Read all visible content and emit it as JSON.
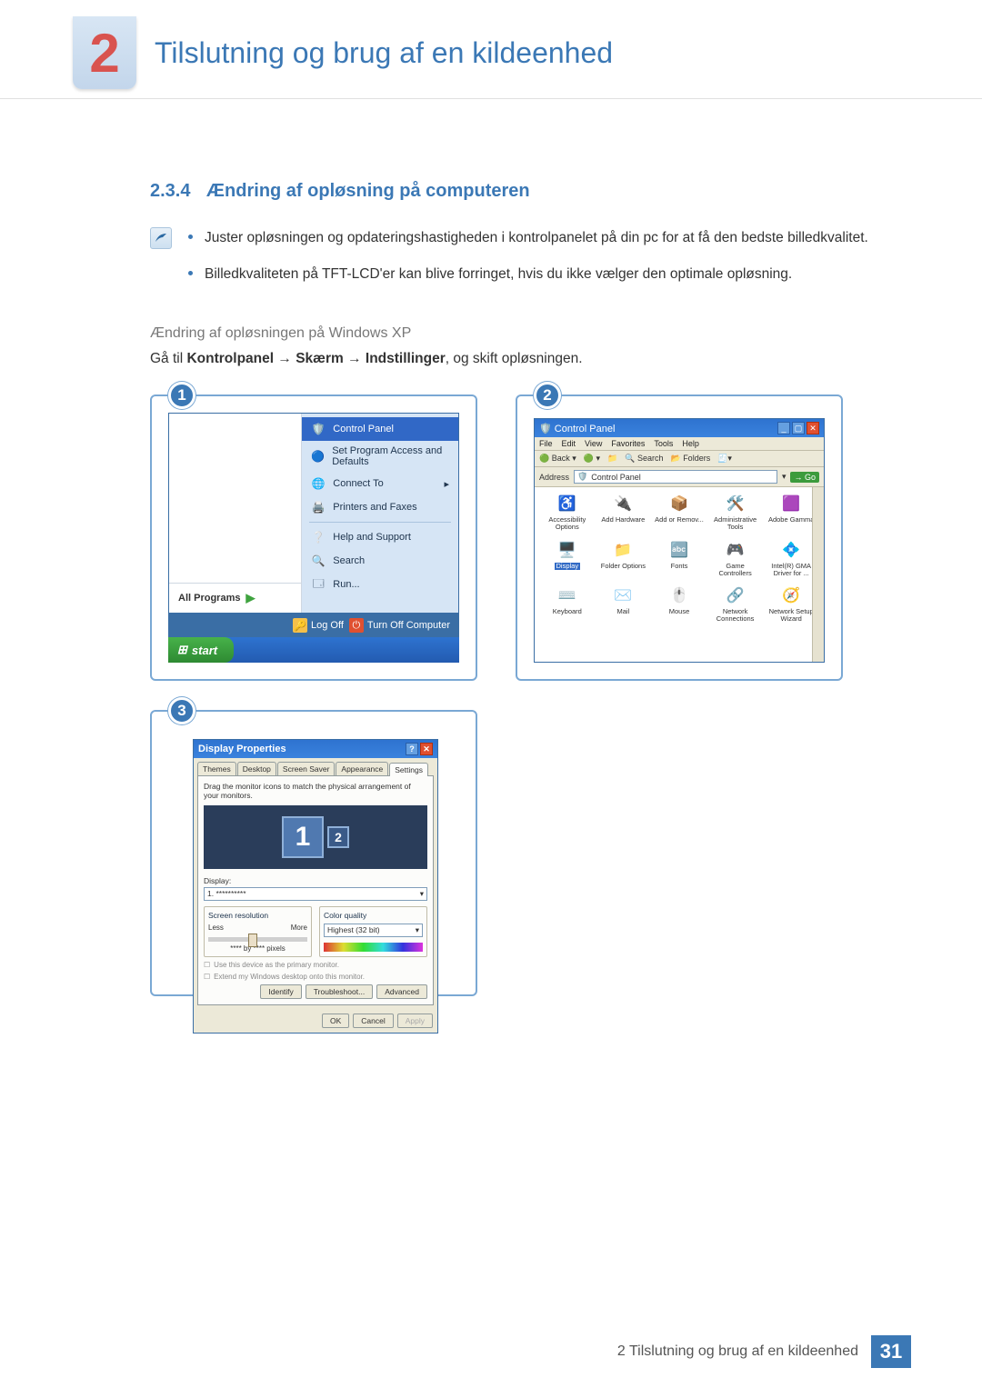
{
  "chapter": {
    "number": "2",
    "title": "Tilslutning og brug af en kildeenhed"
  },
  "section": {
    "number": "2.3.4",
    "title": "Ændring af opløsning på computeren"
  },
  "bullets": [
    "Juster opløsningen og opdateringshastigheden i kontrolpanelet på din pc for at få den bedste billedkvalitet.",
    "Billedkvaliteten på TFT-LCD'er kan blive forringet, hvis du ikke vælger den optimale opløsning."
  ],
  "subhead": "Ændring af opløsningen på Windows XP",
  "path": {
    "prefix": "Gå til ",
    "a": "Kontrolpanel",
    "arrow": " → ",
    "b": "Skærm",
    "c": "Indstillinger",
    "suffix": ", og skift opløsningen."
  },
  "startmenu": {
    "badge": "1",
    "items": [
      {
        "icon": "🛡️",
        "label": "Control Panel",
        "highlight": true
      },
      {
        "icon": "🔵",
        "label": "Set Program Access and Defaults"
      },
      {
        "icon": "🌐",
        "label": "Connect To",
        "arrow": "▸"
      },
      {
        "icon": "🖨️",
        "label": "Printers and Faxes"
      },
      {
        "icon": "❔",
        "label": "Help and Support"
      },
      {
        "icon": "🔍",
        "label": "Search"
      },
      {
        "icon": "🗔",
        "label": "Run..."
      }
    ],
    "all_programs": "All Programs",
    "logoff": "Log Off",
    "turnoff": "Turn Off Computer",
    "start": "start"
  },
  "cp": {
    "badge": "2",
    "title": "Control Panel",
    "menus": [
      "File",
      "Edit",
      "View",
      "Favorites",
      "Tools",
      "Help"
    ],
    "tool_back": "Back",
    "tool_search": "Search",
    "tool_folders": "Folders",
    "addr_label": "Address",
    "addr_value": "Control Panel",
    "go": "Go",
    "items": [
      {
        "ico": "♿",
        "label": "Accessibility Options"
      },
      {
        "ico": "🔌",
        "label": "Add Hardware"
      },
      {
        "ico": "📦",
        "label": "Add or Remov..."
      },
      {
        "ico": "🛠️",
        "label": "Administrative Tools"
      },
      {
        "ico": "🟪",
        "label": "Adobe Gamma"
      },
      {
        "ico": "🖥️",
        "label": "Display",
        "sel": true
      },
      {
        "ico": "📁",
        "label": "Folder Options"
      },
      {
        "ico": "🔤",
        "label": "Fonts"
      },
      {
        "ico": "🎮",
        "label": "Game Controllers"
      },
      {
        "ico": "💠",
        "label": "Intel(R) GMA Driver for ..."
      },
      {
        "ico": "⌨️",
        "label": "Keyboard"
      },
      {
        "ico": "✉️",
        "label": "Mail"
      },
      {
        "ico": "🖱️",
        "label": "Mouse"
      },
      {
        "ico": "🔗",
        "label": "Network Connections"
      },
      {
        "ico": "🧭",
        "label": "Network Setup Wizard"
      }
    ]
  },
  "dp": {
    "badge": "3",
    "title": "Display Properties",
    "tabs": [
      "Themes",
      "Desktop",
      "Screen Saver",
      "Appearance",
      "Settings"
    ],
    "drag": "Drag the monitor icons to match the physical arrangement of your monitors.",
    "mon1": "1",
    "mon2": "2",
    "display_label": "Display:",
    "display_value": "1. **********",
    "res_legend": "Screen resolution",
    "less": "Less",
    "more": "More",
    "pixels": "**** by **** pixels",
    "cq_legend": "Color quality",
    "cq_value": "Highest (32 bit)",
    "chk1": "Use this device as the primary monitor.",
    "chk2": "Extend my Windows desktop onto this monitor.",
    "identify": "Identify",
    "trouble": "Troubleshoot...",
    "advanced": "Advanced",
    "ok": "OK",
    "cancel": "Cancel",
    "apply": "Apply"
  },
  "footer": {
    "text": "2 Tilslutning og brug af en kildeenhed",
    "page": "31"
  }
}
